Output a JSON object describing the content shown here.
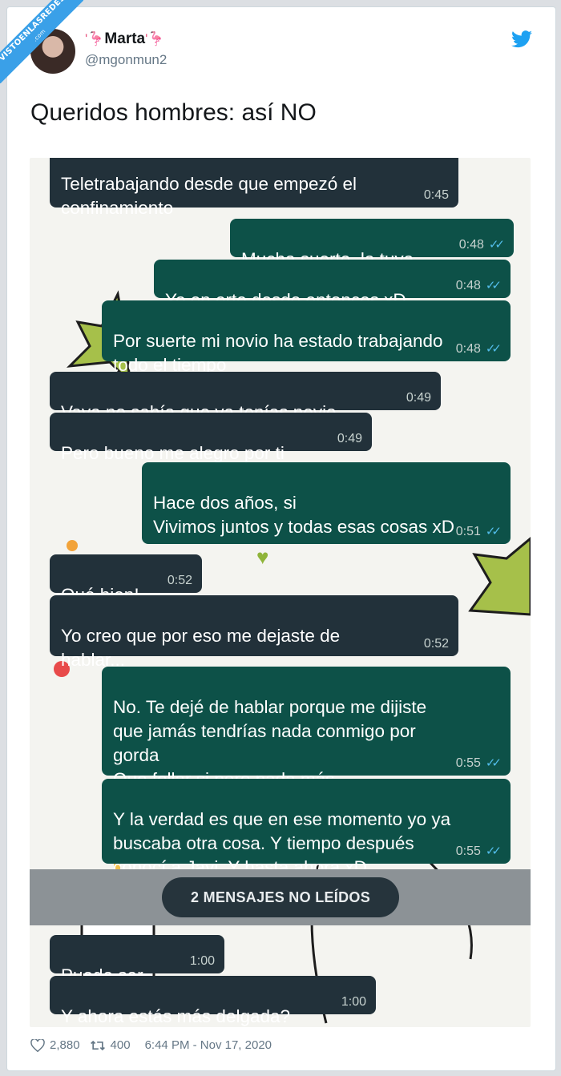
{
  "watermark": {
    "text": "VISTOENLASREDES",
    "sub": ".com"
  },
  "author": {
    "name": "Marta",
    "name_deco_left": "'🦩",
    "name_deco_right": "'🦩",
    "handle": "@mgonmun2"
  },
  "tweet": {
    "text": "Queridos hombres: así NO"
  },
  "chat": {
    "messages": [
      {
        "dir": "in",
        "text": "Teletrabajando desde que empezó el\nconfinamiento",
        "time": "0:45",
        "ticks": ""
      },
      {
        "dir": "out",
        "text": "Mucha suerte, la tuya",
        "time": "0:48",
        "ticks": "✓✓"
      },
      {
        "dir": "out",
        "text": "Yo en erte desde entonces xD",
        "time": "0:48",
        "ticks": "✓✓"
      },
      {
        "dir": "out",
        "text": "Por suerte mi novio ha estado trabajando\ntodo el tiempo",
        "time": "0:48",
        "ticks": "✓✓"
      },
      {
        "dir": "in",
        "text": "Vaya no sabía que ya tenías novio...",
        "time": "0:49",
        "ticks": ""
      },
      {
        "dir": "in",
        "text": "Pero bueno me alegro por ti",
        "time": "0:49",
        "ticks": ""
      },
      {
        "dir": "out",
        "text": "Hace dos años, si\nVivimos juntos y todas esas cosas xD",
        "time": "0:51",
        "ticks": "✓✓"
      },
      {
        "dir": "in",
        "text": "Qué bien!",
        "time": "0:52",
        "ticks": ""
      },
      {
        "dir": "in",
        "text": "Yo creo que por eso me dejaste de\nhablar...",
        "time": "0:52",
        "ticks": ""
      },
      {
        "dir": "out",
        "text": "No. Te dejé de hablar porque me dijiste\nque jamás tendrías nada conmigo por\ngorda\nQue follar si pero nada más",
        "time": "0:55",
        "ticks": "✓✓"
      },
      {
        "dir": "out",
        "text": "Y la verdad es que en ese momento yo ya\nbuscaba otra cosa. Y tiempo después\nconocí a Javi. Y hasta ahora xD",
        "time": "0:55",
        "ticks": "✓✓"
      },
      {
        "dir": "in",
        "text": "Puede ser...",
        "time": "1:00",
        "ticks": ""
      },
      {
        "dir": "in",
        "text": "Y ahora estás más delgada?",
        "time": "1:00",
        "ticks": ""
      }
    ],
    "unread_label": "2 MENSAJES NO LEÍDOS"
  },
  "footer": {
    "likes": "2,880",
    "retweets": "400",
    "timestamp": "6:44 PM - Nov 17, 2020"
  },
  "colors": {
    "outgoing": "#0d5148",
    "incoming": "#22313a",
    "twitter_blue": "#1da1f2"
  }
}
